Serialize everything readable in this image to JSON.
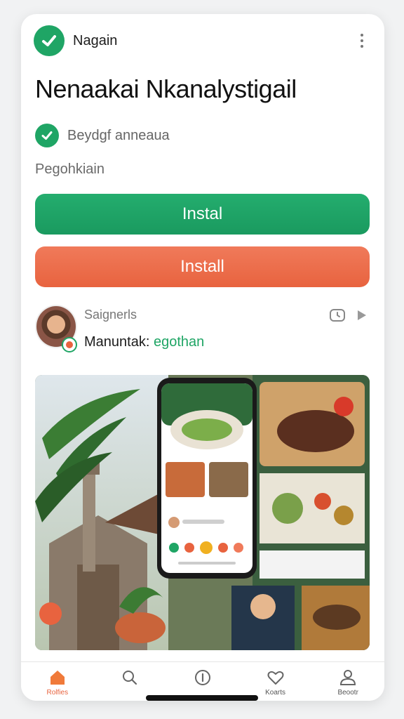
{
  "header": {
    "app_name": "Nagain"
  },
  "app": {
    "title": "Nenaakai Nkanalystigail",
    "verified_text": "Beydgf anneaua",
    "category": "Pegohkiain"
  },
  "buttons": {
    "primary": "Instal",
    "secondary": "Install"
  },
  "developer": {
    "name": "Saignerls",
    "label": "Manuntak:",
    "link": "egothan"
  },
  "nav": {
    "items": [
      {
        "label": "Rolfies",
        "icon": "home-icon"
      },
      {
        "label": "",
        "icon": "search-icon"
      },
      {
        "label": "",
        "icon": "info-icon"
      },
      {
        "label": "Koarts",
        "icon": "heart-icon"
      },
      {
        "label": "Beootr",
        "icon": "profile-icon"
      }
    ]
  },
  "colors": {
    "green": "#1fa565",
    "orange": "#e8633f"
  }
}
